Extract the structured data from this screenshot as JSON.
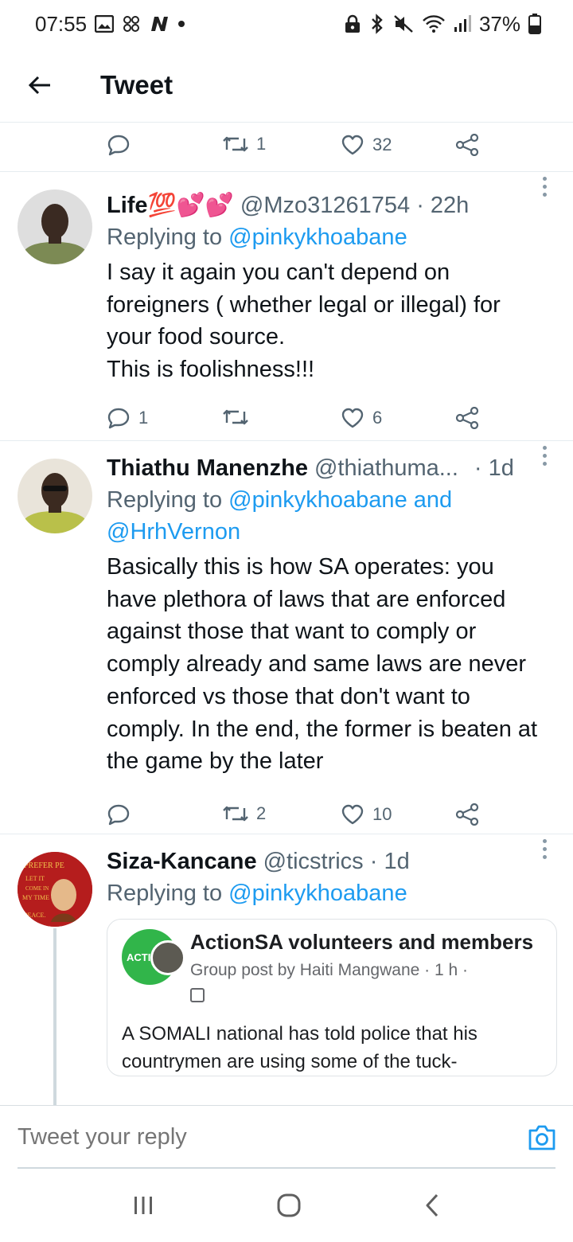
{
  "status_bar": {
    "time": "07:55",
    "battery": "37%"
  },
  "header": {
    "title": "Tweet"
  },
  "top_actions": {
    "retweets": "1",
    "likes": "32"
  },
  "tweets": [
    {
      "name": "Life💯💕💕",
      "handle": "@Mzo31261754 · 22h",
      "reply_prefix": "Replying to ",
      "reply_mentions": "@pinkykhoabane",
      "text": "I say it again you can't depend on foreigners ( whether legal or illegal) for your food source.\nThis is foolishness!!!",
      "replies": "1",
      "retweets": "",
      "likes": "6"
    },
    {
      "name": "Thiathu Manenzhe",
      "handle": "@thiathuma...",
      "time": "· 1d",
      "reply_prefix": "Replying to ",
      "reply_mentions": "@pinkykhoabane and @HrhVernon",
      "text": "Basically this is how SA operates: you have plethora of laws that are enforced against those that want to comply or comply already and same laws are never enforced vs those that don't want to comply. In the end, the former is beaten at the game by the later",
      "replies": "",
      "retweets": "2",
      "likes": "10"
    },
    {
      "name": "Siza-Kancane",
      "handle": "@ticstrics · 1d",
      "reply_prefix": "Replying to ",
      "reply_mentions": "@pinkykhoabane",
      "avatar_text": "PREFER PEACE LET IT COME IN MY TIME SO MY CHILDREN MAY LIVE IN PEACE",
      "embed": {
        "group_name": "ActionSA volunteers and members",
        "meta": "Group post by Haiti Mangwane · 1 h ·",
        "avatar_label": "ACTI",
        "text": "A SOMALI national has told police that his countrymen are using some of the tuck-"
      }
    }
  ],
  "reply_bar": {
    "placeholder": "Tweet your reply"
  },
  "colors": {
    "link": "#1d9bf0",
    "secondary_text": "#536471",
    "divider": "#e6ecf0"
  }
}
